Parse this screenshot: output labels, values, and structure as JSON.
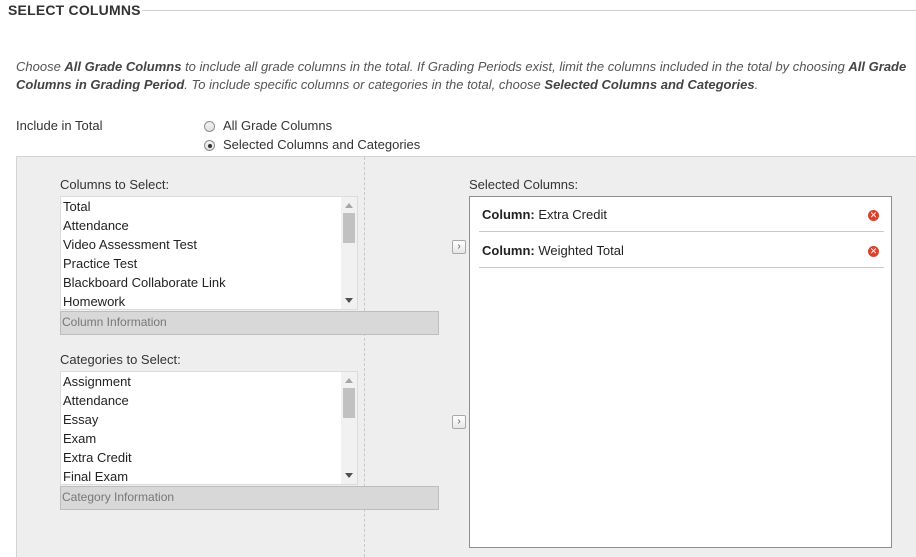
{
  "section": {
    "title": "SELECT COLUMNS"
  },
  "instructions": {
    "p1": "Choose ",
    "b1": "All Grade Columns",
    "p2": " to include all grade columns in the total. If Grading Periods exist, limit the columns included in the total by choosing ",
    "b2": "All Grade",
    "b3": "Columns in Grading Period",
    "p3": ". To include specific columns or categories in the total, choose ",
    "b4": "Selected Columns and Categories",
    "p4": "."
  },
  "include": {
    "label": "Include in Total",
    "options": [
      {
        "label": "All Grade Columns",
        "checked": false
      },
      {
        "label": "Selected Columns and Categories",
        "checked": true
      }
    ]
  },
  "columns": {
    "label": "Columns to Select:",
    "items": [
      "Total",
      "Attendance",
      "Video Assessment Test",
      "Practice Test",
      "Blackboard Collaborate Link",
      "Homework"
    ],
    "info": "Column Information",
    "add_icon": "chevron-right-icon"
  },
  "categories": {
    "label": "Categories to Select:",
    "items": [
      "Assignment",
      "Attendance",
      "Essay",
      "Exam",
      "Extra Credit",
      "Final Exam"
    ],
    "info": "Category Information",
    "add_icon": "chevron-right-icon"
  },
  "selected": {
    "label": "Selected Columns:",
    "items": [
      {
        "prefix": "Column:",
        "name": "Extra Credit"
      },
      {
        "prefix": "Column:",
        "name": "Weighted Total"
      }
    ],
    "remove_icon": "remove-icon"
  },
  "colors": {
    "remove": "#d9432e",
    "panel": "#eeeeee"
  }
}
